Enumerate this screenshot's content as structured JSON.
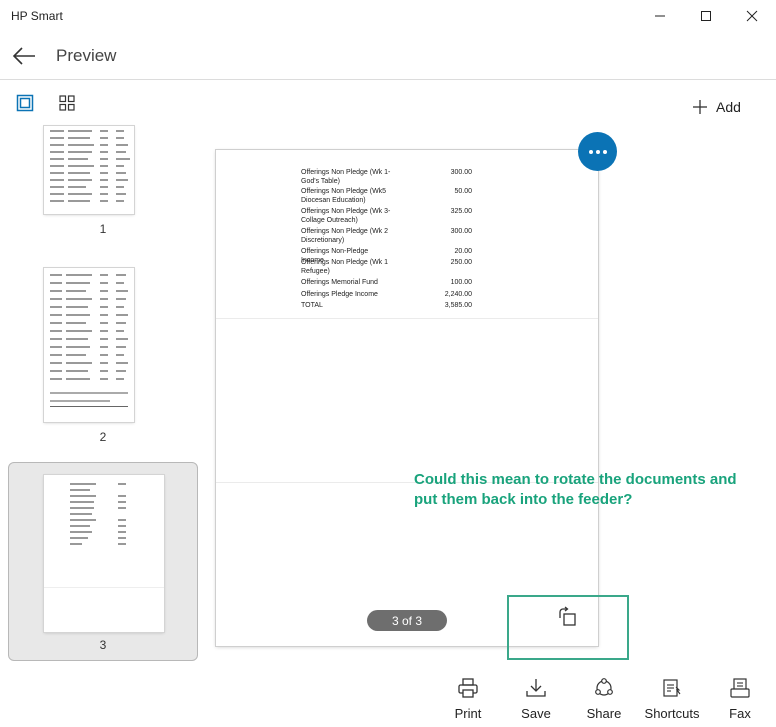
{
  "window": {
    "app_title": "HP Smart"
  },
  "header": {
    "title": "Preview"
  },
  "toolbar": {
    "add_label": "Add"
  },
  "thumbnails": [
    {
      "number": "1",
      "selected": false
    },
    {
      "number": "2",
      "selected": false
    },
    {
      "number": "3",
      "selected": true
    }
  ],
  "document": {
    "rows": [
      {
        "label": "Offerings Non Pledge (Wk 1-God's Table)",
        "amount": "300.00"
      },
      {
        "label": "Offerings Non Pledge (Wk5 Diocesan Education)",
        "amount": "50.00"
      },
      {
        "label": "Offerings Non Pledge (Wk 3-Collage Outreach)",
        "amount": "325.00"
      },
      {
        "label": "Offerings Non Pledge (Wk 2 Discretionary)",
        "amount": "300.00"
      },
      {
        "label": "Offerings Non-Pledge Income",
        "amount": "20.00"
      },
      {
        "label": "Offerings Non Pledge (Wk 1 Refugee)",
        "amount": "250.00"
      },
      {
        "label": "Offerings Memorial Fund",
        "amount": "100.00"
      },
      {
        "label": "Offerings Pledge Income",
        "amount": "2,240.00"
      },
      {
        "label": "TOTAL",
        "amount": "3,585.00"
      }
    ]
  },
  "page_indicator": "3 of 3",
  "annotation": "Could this mean to rotate the documents and put them back into the feeder?",
  "bottom_bar": {
    "print": "Print",
    "save": "Save",
    "share": "Share",
    "shortcuts": "Shortcuts",
    "fax": "Fax"
  },
  "colors": {
    "accent": "#0b73b5",
    "annotation": "#19a37c",
    "highlight_border": "#3aa88a",
    "indicator_bg": "#6e6e6e"
  }
}
